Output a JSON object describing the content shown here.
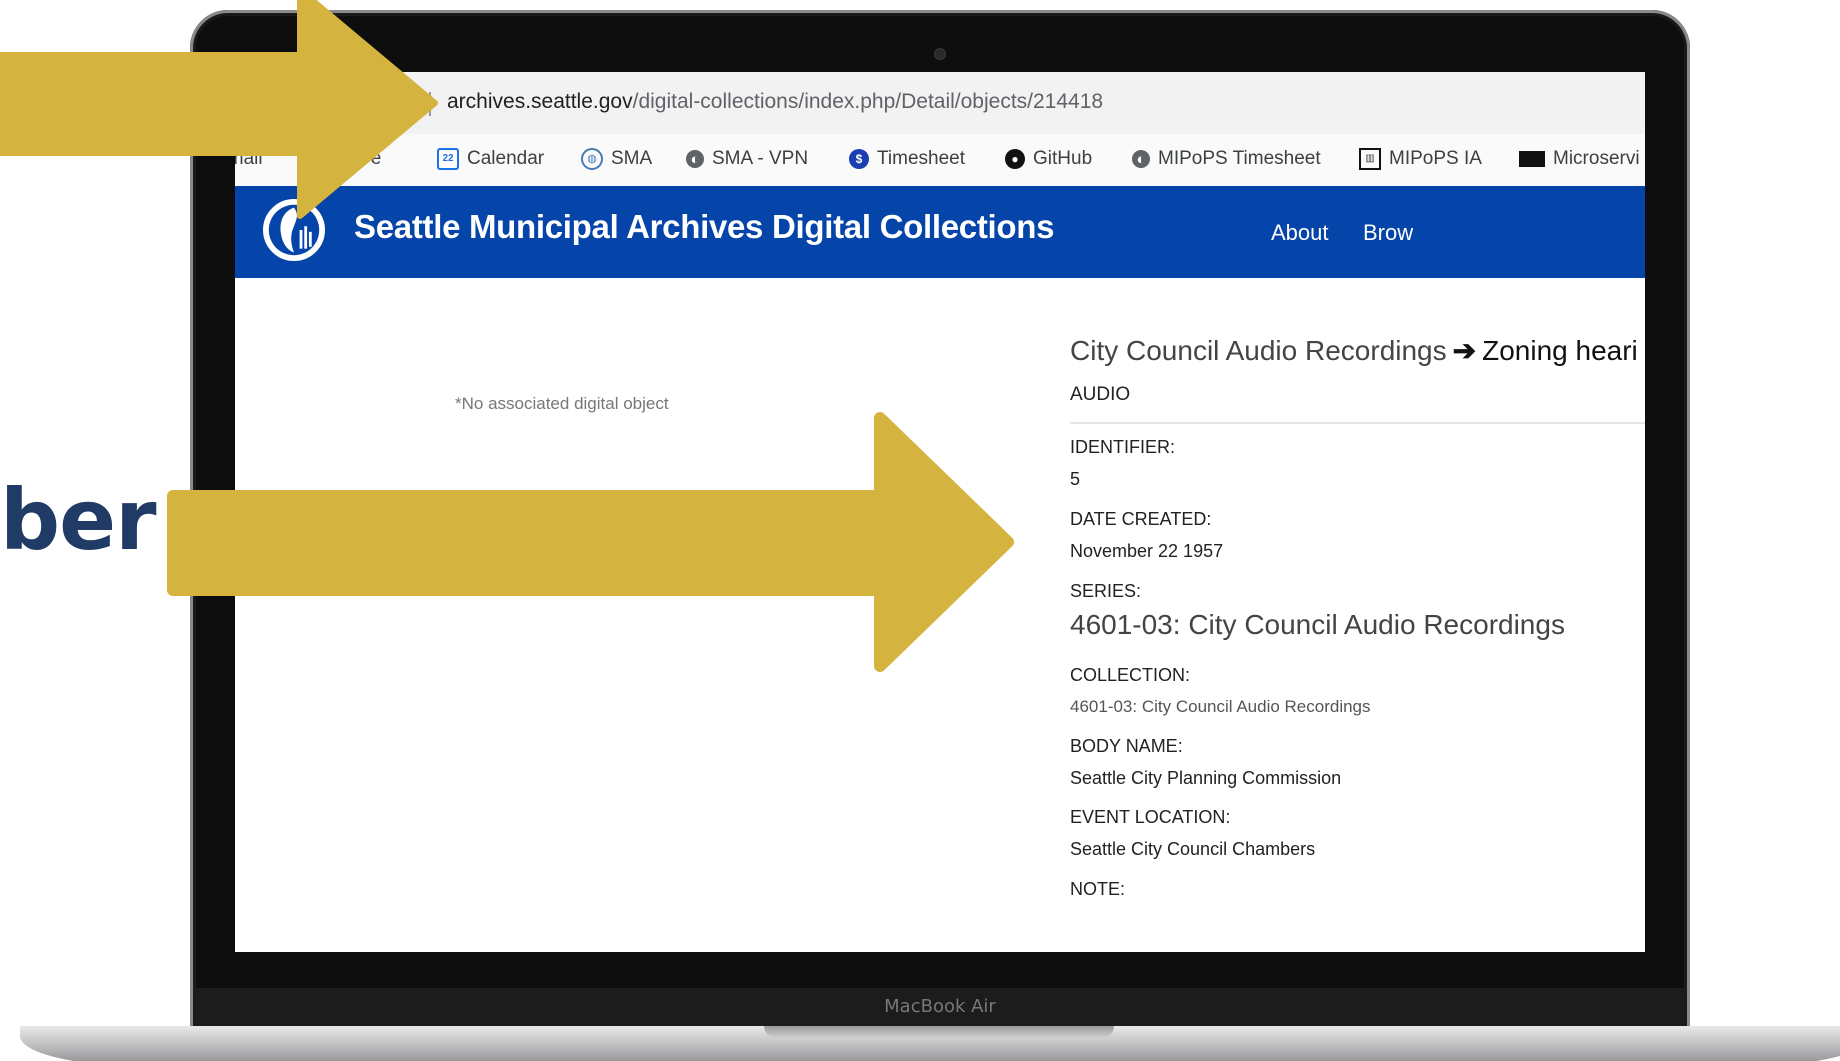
{
  "slide": {
    "partial_word": "ber"
  },
  "browser": {
    "url_domain": "archives.seattle.gov",
    "url_path": "/digital-collections/index.php/Detail/objects/214418",
    "bookmarks": [
      {
        "label": "Gmail",
        "icon": "gmail-icon"
      },
      {
        "label": "Drive",
        "icon": "drive-icon"
      },
      {
        "label": "Calendar",
        "icon": "calendar-icon"
      },
      {
        "label": "SMA",
        "icon": "sma-icon"
      },
      {
        "label": "SMA - VPN",
        "icon": "globe-icon"
      },
      {
        "label": "Timesheet",
        "icon": "timesheet-icon"
      },
      {
        "label": "GitHub",
        "icon": "github-icon"
      },
      {
        "label": "MIPoPS Timesheet",
        "icon": "globe-icon"
      },
      {
        "label": "MIPoPS IA",
        "icon": "building-icon"
      },
      {
        "label": "Microservi",
        "icon": "card-icon"
      }
    ]
  },
  "site": {
    "title": "Seattle Municipal Archives Digital Collections",
    "nav": {
      "about": "About",
      "browse": "Brow"
    },
    "colors": {
      "header": "#0544a8"
    }
  },
  "record": {
    "no_object_note": "*No associated digital object",
    "breadcrumb_parent": "City Council Audio Recordings",
    "breadcrumb_arrow": "➔",
    "breadcrumb_current": "Zoning heari",
    "type": "AUDIO",
    "identifier_label": "IDENTIFIER:",
    "identifier_value": "5",
    "date_label": "DATE CREATED:",
    "date_value": "November 22 1957",
    "series_label": "SERIES:",
    "series_value": "4601-03: City Council Audio Recordings",
    "collection_label": "COLLECTION:",
    "collection_value": "4601-03: City Council Audio Recordings",
    "body_label": "BODY NAME:",
    "body_value": "Seattle City Planning Commission",
    "location_label": "EVENT LOCATION:",
    "location_value": "Seattle City Council Chambers",
    "note_label": "NOTE:"
  },
  "device": {
    "brand": "MacBook Air"
  },
  "annotations": {
    "arrow_color": "#d4b43e"
  }
}
